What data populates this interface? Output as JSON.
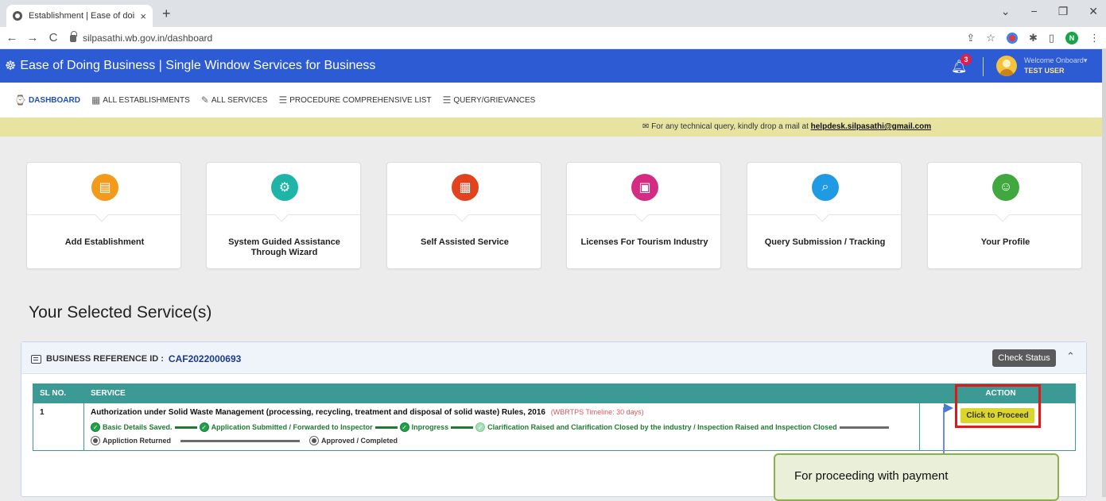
{
  "browser": {
    "tab_title": "Establishment | Ease of doing bu",
    "tab_close": "×",
    "new_tab": "+",
    "url": "silpasathi.wb.gov.in/dashboard",
    "window_controls": [
      "⌄",
      "−",
      "❐",
      "✕"
    ],
    "profile_initial": "N"
  },
  "header": {
    "brand_icon": "☸",
    "title": "Ease of Doing Business | Single Window Services for Business",
    "notification_count": "3",
    "welcome": "Welcome Onboard▾",
    "user": "TEST USER"
  },
  "menu": [
    {
      "icon": "⌚",
      "label": "DASHBOARD"
    },
    {
      "icon": "▦",
      "label": "ALL ESTABLISHMENTS"
    },
    {
      "icon": "✎",
      "label": "ALL SERVICES"
    },
    {
      "icon": "☰",
      "label": "PROCEDURE COMPREHENSIVE LIST"
    },
    {
      "icon": "☰",
      "label": "QUERY/GRIEVANCES"
    }
  ],
  "notice": {
    "text": "For any technical query, kindly drop a mail at",
    "email": "helpdesk.silpasathi@gmail.com"
  },
  "cards": [
    {
      "label": "Add Establishment",
      "color": "#f39a1b",
      "icon": "▤"
    },
    {
      "label": "System Guided Assistance Through Wizard",
      "color": "#1eb5a8",
      "icon": "⚙"
    },
    {
      "label": "Self Assisted Service",
      "color": "#e2421e",
      "icon": "▦"
    },
    {
      "label": "Licenses For Tourism Industry",
      "color": "#d62b83",
      "icon": "▣"
    },
    {
      "label": "Query Submission / Tracking",
      "color": "#1e9be4",
      "icon": "⌕"
    },
    {
      "label": "Your Profile",
      "color": "#41a83f",
      "icon": "☺"
    }
  ],
  "section_title": "Your Selected Service(s)",
  "panel": {
    "ref_label": "BUSINESS REFERENCE ID :",
    "ref_id": "CAF2022000693",
    "check_status": "Check Status",
    "collapse_icon": "⌃"
  },
  "table": {
    "headers": [
      "SL NO.",
      "SERVICE",
      "ACTION"
    ],
    "row": {
      "sl": "1",
      "service": "Authorization under Solid Waste Management (processing, recycling, treatment and disposal of solid waste) Rules, 2016",
      "timeline": "(WBRTPS Timeline: 30 days)",
      "steps": [
        "Basic Details Saved.",
        "Application Submitted / Forwarded to Inspector",
        "Inprogress",
        "Clarification Raised and Clarification Closed by the industry / Inspection Raised and Inspection Closed",
        "Appliction Returned",
        "Approved / Completed"
      ],
      "action": "Click to Proceed"
    }
  },
  "callout": "For proceeding with payment"
}
